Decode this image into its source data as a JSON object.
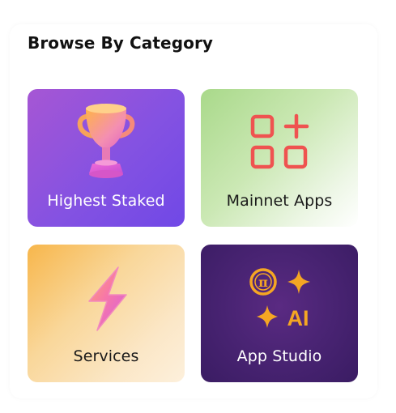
{
  "section": {
    "title": "Browse By Category"
  },
  "categories": [
    {
      "label": "Highest Staked",
      "icon": "trophy-icon"
    },
    {
      "label": "Mainnet Apps",
      "icon": "apps-grid-icon"
    },
    {
      "label": "Services",
      "icon": "lightning-bolt-icon"
    },
    {
      "label": "App Studio",
      "icon": "pi-sparkle-ai-icon",
      "icon_text": "AI",
      "icon_symbol": "π"
    }
  ],
  "colors": {
    "card_highest_staked": "#8452e2",
    "card_mainnet_apps": "#cbe8b4",
    "card_services": "#f9d79a",
    "card_app_studio": "#4a2474",
    "apps_icon": "#ef5350",
    "app_studio_icon": "#f5a623"
  }
}
